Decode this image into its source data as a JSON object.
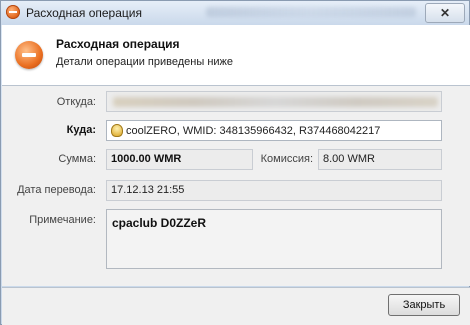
{
  "window": {
    "title": "Расходная операция",
    "close_symbol": "✕"
  },
  "header": {
    "title": "Расходная операция",
    "subtitle": "Детали операции приведены ниже",
    "icon": "minus-circle-icon"
  },
  "form": {
    "from_label": "Откуда:",
    "to_label": "Куда:",
    "to_value": "coolZERO, WMID: 348135966432, R374468042217",
    "amount_label": "Сумма:",
    "amount_value": "1000.00 WMR",
    "commission_label": "Комиссия:",
    "commission_value": "8.00 WMR",
    "date_label": "Дата перевода:",
    "date_value": "17.12.13 21:55",
    "note_label": "Примечание:",
    "note_value": "cpaclub D0ZZeR"
  },
  "footer": {
    "close_label": "Закрыть"
  },
  "colors": {
    "accent": "#e36a1e",
    "background": "#f0f0f0"
  }
}
